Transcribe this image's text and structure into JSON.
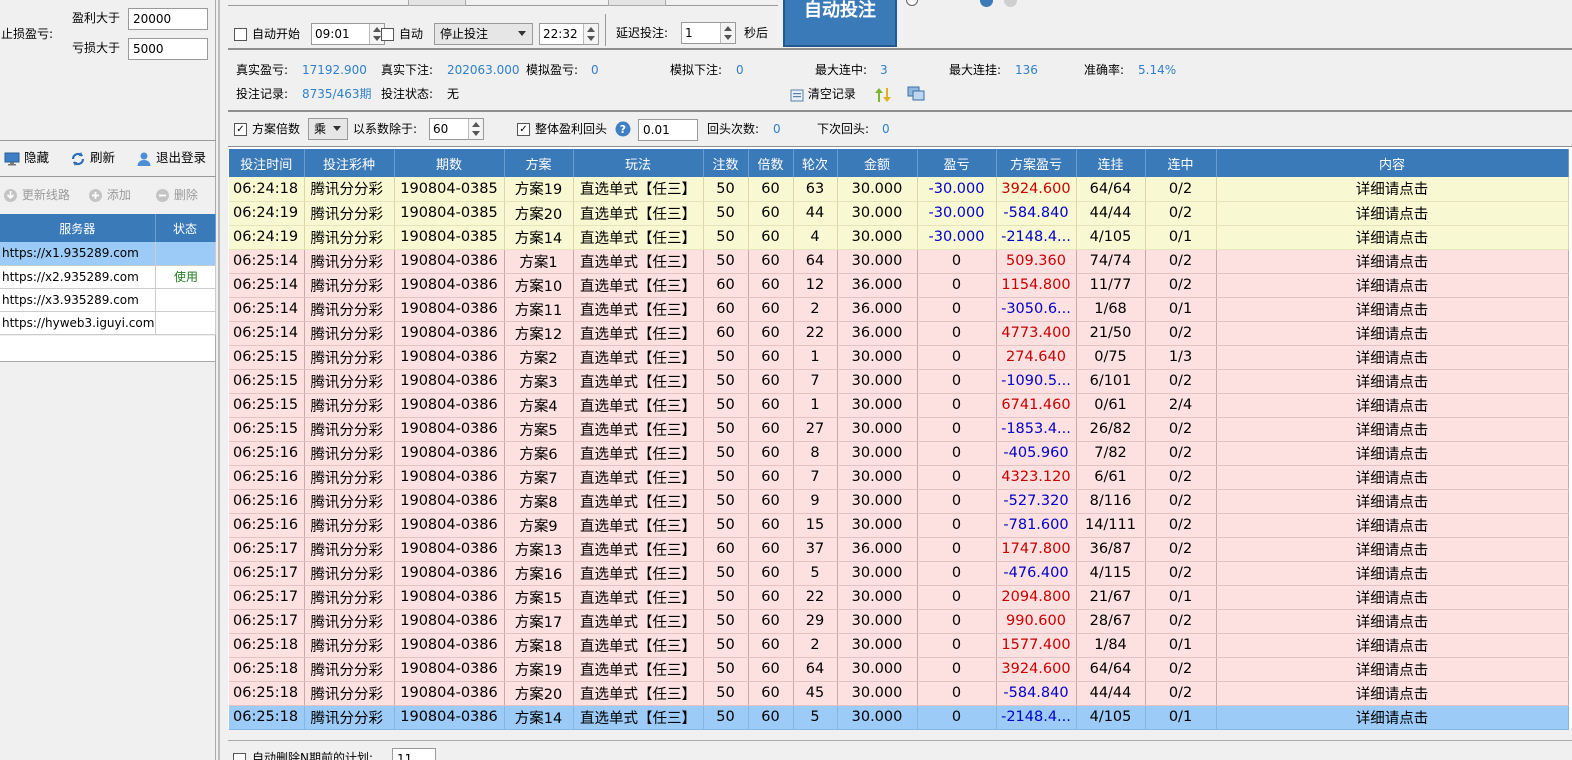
{
  "left": {
    "stop_label": "止损盈亏:",
    "profit_gt_label": "盈利大于",
    "profit_gt_value": "20000",
    "loss_gt_label": "亏损大于",
    "loss_gt_value": "5000",
    "hide_label": "隐藏",
    "refresh_label": "刷新",
    "logout_label": "退出登录",
    "update_line_label": "更新线路",
    "add_label": "添加",
    "delete_label": "删除",
    "server_col": "服务器",
    "status_col": "状态",
    "servers": [
      {
        "url": "https://x1.935289.com",
        "status": ""
      },
      {
        "url": "https://x2.935289.com",
        "status": "使用"
      },
      {
        "url": "https://x3.935289.com",
        "status": ""
      },
      {
        "url": "https://hyweb3.iguyi.com",
        "status": ""
      }
    ]
  },
  "top": {
    "auto_start_label": "自动开始",
    "auto_start_time": "09:01",
    "auto_label": "自动",
    "stop_select": "停止投注",
    "stop_time": "22:32",
    "delay_label": "延迟投注:",
    "delay_value": "1",
    "seconds_label": "秒后",
    "auto_bet_button": "自动投注"
  },
  "stats": {
    "real_pl_label": "真实盈亏:",
    "real_pl": "17192.900",
    "real_bet_label": "真实下注:",
    "real_bet": "202063.000",
    "sim_pl_label": "模拟盈亏:",
    "sim_pl": "0",
    "sim_bet_label": "模拟下注:",
    "sim_bet": "0",
    "max_win_label": "最大连中:",
    "max_win": "3",
    "max_lose_label": "最大连挂:",
    "max_lose": "136",
    "accuracy_label": "准确率:",
    "accuracy": "5.14%",
    "record_label": "投注记录:",
    "record": "8735/463期",
    "state_label": "投注状态:",
    "state": "无",
    "clear_label": "清空记录"
  },
  "options": {
    "multiple_label": "方案倍数",
    "op_select": "乘",
    "divide_label": "以系数除于:",
    "divide_value": "60",
    "overall_label": "整体盈利回头",
    "overall_value": "0.01",
    "back_count_label": "回头次数:",
    "back_count": "0",
    "next_back_label": "下次回头:",
    "next_back": "0"
  },
  "bottom": {
    "auto_delete_label": "自动删除N期前的计划:",
    "auto_delete_value": "11"
  },
  "table": {
    "headers": [
      "投注时间",
      "投注彩种",
      "期数",
      "方案",
      "玩法",
      "注数",
      "倍数",
      "轮次",
      "金额",
      "盈亏",
      "方案盈亏",
      "连挂",
      "连中",
      "内容"
    ],
    "rows": [
      [
        "06:24:18",
        "腾讯分分彩",
        "190804-0385",
        "方案19",
        "直选单式【任三】",
        "50",
        "60",
        "63",
        "30.000",
        "-30.000",
        "3924.600",
        "64/64",
        "0/2",
        "详细请点击"
      ],
      [
        "06:24:19",
        "腾讯分分彩",
        "190804-0385",
        "方案20",
        "直选单式【任三】",
        "50",
        "60",
        "44",
        "30.000",
        "-30.000",
        "-584.840",
        "44/44",
        "0/2",
        "详细请点击"
      ],
      [
        "06:24:19",
        "腾讯分分彩",
        "190804-0385",
        "方案14",
        "直选单式【任三】",
        "50",
        "60",
        "4",
        "30.000",
        "-30.000",
        "-2148.4...",
        "4/105",
        "0/1",
        "详细请点击"
      ],
      [
        "06:25:14",
        "腾讯分分彩",
        "190804-0386",
        "方案1",
        "直选单式【任三】",
        "50",
        "60",
        "64",
        "30.000",
        "0",
        "509.360",
        "74/74",
        "0/2",
        "详细请点击"
      ],
      [
        "06:25:14",
        "腾讯分分彩",
        "190804-0386",
        "方案10",
        "直选单式【任三】",
        "60",
        "60",
        "12",
        "36.000",
        "0",
        "1154.800",
        "11/77",
        "0/2",
        "详细请点击"
      ],
      [
        "06:25:14",
        "腾讯分分彩",
        "190804-0386",
        "方案11",
        "直选单式【任三】",
        "60",
        "60",
        "2",
        "36.000",
        "0",
        "-3050.6...",
        "1/68",
        "0/1",
        "详细请点击"
      ],
      [
        "06:25:14",
        "腾讯分分彩",
        "190804-0386",
        "方案12",
        "直选单式【任三】",
        "60",
        "60",
        "22",
        "36.000",
        "0",
        "4773.400",
        "21/50",
        "0/2",
        "详细请点击"
      ],
      [
        "06:25:15",
        "腾讯分分彩",
        "190804-0386",
        "方案2",
        "直选单式【任三】",
        "50",
        "60",
        "1",
        "30.000",
        "0",
        "274.640",
        "0/75",
        "1/3",
        "详细请点击"
      ],
      [
        "06:25:15",
        "腾讯分分彩",
        "190804-0386",
        "方案3",
        "直选单式【任三】",
        "50",
        "60",
        "7",
        "30.000",
        "0",
        "-1090.5...",
        "6/101",
        "0/2",
        "详细请点击"
      ],
      [
        "06:25:15",
        "腾讯分分彩",
        "190804-0386",
        "方案4",
        "直选单式【任三】",
        "50",
        "60",
        "1",
        "30.000",
        "0",
        "6741.460",
        "0/61",
        "2/4",
        "详细请点击"
      ],
      [
        "06:25:15",
        "腾讯分分彩",
        "190804-0386",
        "方案5",
        "直选单式【任三】",
        "50",
        "60",
        "27",
        "30.000",
        "0",
        "-1853.4...",
        "26/82",
        "0/2",
        "详细请点击"
      ],
      [
        "06:25:16",
        "腾讯分分彩",
        "190804-0386",
        "方案6",
        "直选单式【任三】",
        "50",
        "60",
        "8",
        "30.000",
        "0",
        "-405.960",
        "7/82",
        "0/2",
        "详细请点击"
      ],
      [
        "06:25:16",
        "腾讯分分彩",
        "190804-0386",
        "方案7",
        "直选单式【任三】",
        "50",
        "60",
        "7",
        "30.000",
        "0",
        "4323.120",
        "6/61",
        "0/2",
        "详细请点击"
      ],
      [
        "06:25:16",
        "腾讯分分彩",
        "190804-0386",
        "方案8",
        "直选单式【任三】",
        "50",
        "60",
        "9",
        "30.000",
        "0",
        "-527.320",
        "8/116",
        "0/2",
        "详细请点击"
      ],
      [
        "06:25:16",
        "腾讯分分彩",
        "190804-0386",
        "方案9",
        "直选单式【任三】",
        "50",
        "60",
        "15",
        "30.000",
        "0",
        "-781.600",
        "14/111",
        "0/2",
        "详细请点击"
      ],
      [
        "06:25:17",
        "腾讯分分彩",
        "190804-0386",
        "方案13",
        "直选单式【任三】",
        "60",
        "60",
        "37",
        "36.000",
        "0",
        "1747.800",
        "36/87",
        "0/2",
        "详细请点击"
      ],
      [
        "06:25:17",
        "腾讯分分彩",
        "190804-0386",
        "方案16",
        "直选单式【任三】",
        "50",
        "60",
        "5",
        "30.000",
        "0",
        "-476.400",
        "4/115",
        "0/2",
        "详细请点击"
      ],
      [
        "06:25:17",
        "腾讯分分彩",
        "190804-0386",
        "方案15",
        "直选单式【任三】",
        "50",
        "60",
        "22",
        "30.000",
        "0",
        "2094.800",
        "21/67",
        "0/1",
        "详细请点击"
      ],
      [
        "06:25:17",
        "腾讯分分彩",
        "190804-0386",
        "方案17",
        "直选单式【任三】",
        "50",
        "60",
        "29",
        "30.000",
        "0",
        "990.600",
        "28/67",
        "0/2",
        "详细请点击"
      ],
      [
        "06:25:18",
        "腾讯分分彩",
        "190804-0386",
        "方案18",
        "直选单式【任三】",
        "50",
        "60",
        "2",
        "30.000",
        "0",
        "1577.400",
        "1/84",
        "0/1",
        "详细请点击"
      ],
      [
        "06:25:18",
        "腾讯分分彩",
        "190804-0386",
        "方案19",
        "直选单式【任三】",
        "50",
        "60",
        "64",
        "30.000",
        "0",
        "3924.600",
        "64/64",
        "0/2",
        "详细请点击"
      ],
      [
        "06:25:18",
        "腾讯分分彩",
        "190804-0386",
        "方案20",
        "直选单式【任三】",
        "50",
        "60",
        "45",
        "30.000",
        "0",
        "-584.840",
        "44/44",
        "0/2",
        "详细请点击"
      ],
      [
        "06:25:18",
        "腾讯分分彩",
        "190804-0386",
        "方案14",
        "直选单式【任三】",
        "50",
        "60",
        "5",
        "30.000",
        "0",
        "-2148.4...",
        "4/105",
        "0/1",
        "详细请点击"
      ]
    ],
    "row_styles": [
      "yel",
      "yel",
      "yel",
      "pink",
      "pink",
      "pink",
      "pink",
      "pink",
      "pink",
      "pink",
      "pink",
      "pink",
      "pink",
      "pink",
      "pink",
      "pink",
      "pink",
      "pink",
      "pink",
      "pink",
      "pink",
      "pink",
      "selr"
    ]
  },
  "colors": {
    "header": "#3b7ab9",
    "accent": "#2f7fcc",
    "yellow_row": "#f8f8d2",
    "pink_row": "#fde1e1",
    "selected_row": "#9bcbf6",
    "negative": "#0000c8",
    "positive": "#c80000"
  }
}
